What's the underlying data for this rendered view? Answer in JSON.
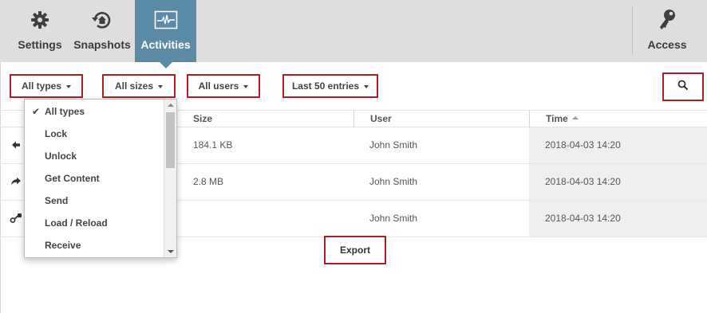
{
  "toolbar": {
    "tabs": [
      {
        "label": "Settings",
        "icon": "gear-icon"
      },
      {
        "label": "Snapshots",
        "icon": "snapshot-history-icon"
      },
      {
        "label": "Activities",
        "icon": "activity-pulse-icon",
        "active": true
      },
      {
        "label": "Access",
        "icon": "key-icon"
      }
    ],
    "active_color": "#5b8ba6",
    "background": "#dedede"
  },
  "filters": {
    "types": "All types",
    "sizes": "All sizes",
    "users": "All users",
    "entries": "Last 50 entries",
    "search_icon": "search-icon"
  },
  "types_dropdown": {
    "selected": "All types",
    "options": [
      "All types",
      "Lock",
      "Unlock",
      "Get Content",
      "Send",
      "Load / Reload",
      "Receive"
    ]
  },
  "table": {
    "headers": {
      "size": "Size",
      "user": "User",
      "time": "Time"
    },
    "sort_column": "Time",
    "rows": [
      {
        "icon": "arrow-left-icon",
        "size": "184.1 KB",
        "user": "John Smith",
        "time": "2018-04-03 14:20"
      },
      {
        "icon": "share-forward-icon",
        "size": "2.8 MB",
        "user": "John Smith",
        "time": "2018-04-03 14:20"
      },
      {
        "icon": "key-lock-icon",
        "size": "",
        "user": "John Smith",
        "time": "2018-04-03 14:20"
      }
    ]
  },
  "actions": {
    "export_label": "Export"
  },
  "highlight_color": "#b01e25"
}
